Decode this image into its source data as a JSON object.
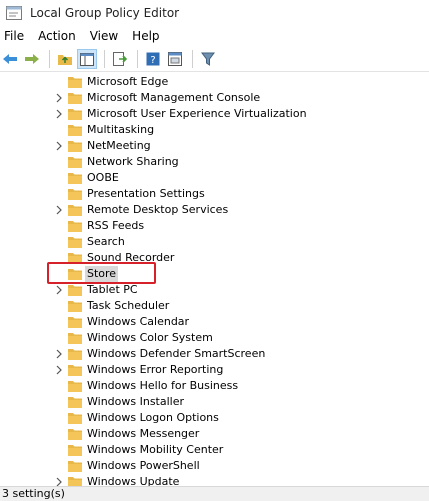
{
  "window": {
    "title": "Local Group Policy Editor"
  },
  "menu": [
    "File",
    "Action",
    "View",
    "Help"
  ],
  "toolbar": {
    "buttons": [
      "back-arrow-icon",
      "forward-arrow-icon",
      "up-folder-icon",
      "show-hide-tree-icon",
      "export-list-icon",
      "help-icon",
      "properties-icon",
      "filter-icon"
    ]
  },
  "tree": {
    "items": [
      {
        "label": "Microsoft Edge",
        "expandable": false
      },
      {
        "label": "Microsoft Management Console",
        "expandable": true
      },
      {
        "label": "Microsoft User Experience Virtualization",
        "expandable": true
      },
      {
        "label": "Multitasking",
        "expandable": false
      },
      {
        "label": "NetMeeting",
        "expandable": true
      },
      {
        "label": "Network Sharing",
        "expandable": false
      },
      {
        "label": "OOBE",
        "expandable": false
      },
      {
        "label": "Presentation Settings",
        "expandable": false
      },
      {
        "label": "Remote Desktop Services",
        "expandable": true
      },
      {
        "label": "RSS Feeds",
        "expandable": false
      },
      {
        "label": "Search",
        "expandable": false
      },
      {
        "label": "Sound Recorder",
        "expandable": false
      },
      {
        "label": "Store",
        "expandable": false,
        "selected": true
      },
      {
        "label": "Tablet PC",
        "expandable": true
      },
      {
        "label": "Task Scheduler",
        "expandable": false
      },
      {
        "label": "Windows Calendar",
        "expandable": false
      },
      {
        "label": "Windows Color System",
        "expandable": false
      },
      {
        "label": "Windows Defender SmartScreen",
        "expandable": true
      },
      {
        "label": "Windows Error Reporting",
        "expandable": true
      },
      {
        "label": "Windows Hello for Business",
        "expandable": false
      },
      {
        "label": "Windows Installer",
        "expandable": false
      },
      {
        "label": "Windows Logon Options",
        "expandable": false
      },
      {
        "label": "Windows Messenger",
        "expandable": false
      },
      {
        "label": "Windows Mobility Center",
        "expandable": false
      },
      {
        "label": "Windows PowerShell",
        "expandable": false
      },
      {
        "label": "Windows Update",
        "expandable": true
      }
    ]
  },
  "status": {
    "text": "3 setting(s)"
  },
  "colors": {
    "highlight": "#d6202a",
    "folder": "#f4c65a",
    "selected_bg": "#d9d9d9"
  }
}
